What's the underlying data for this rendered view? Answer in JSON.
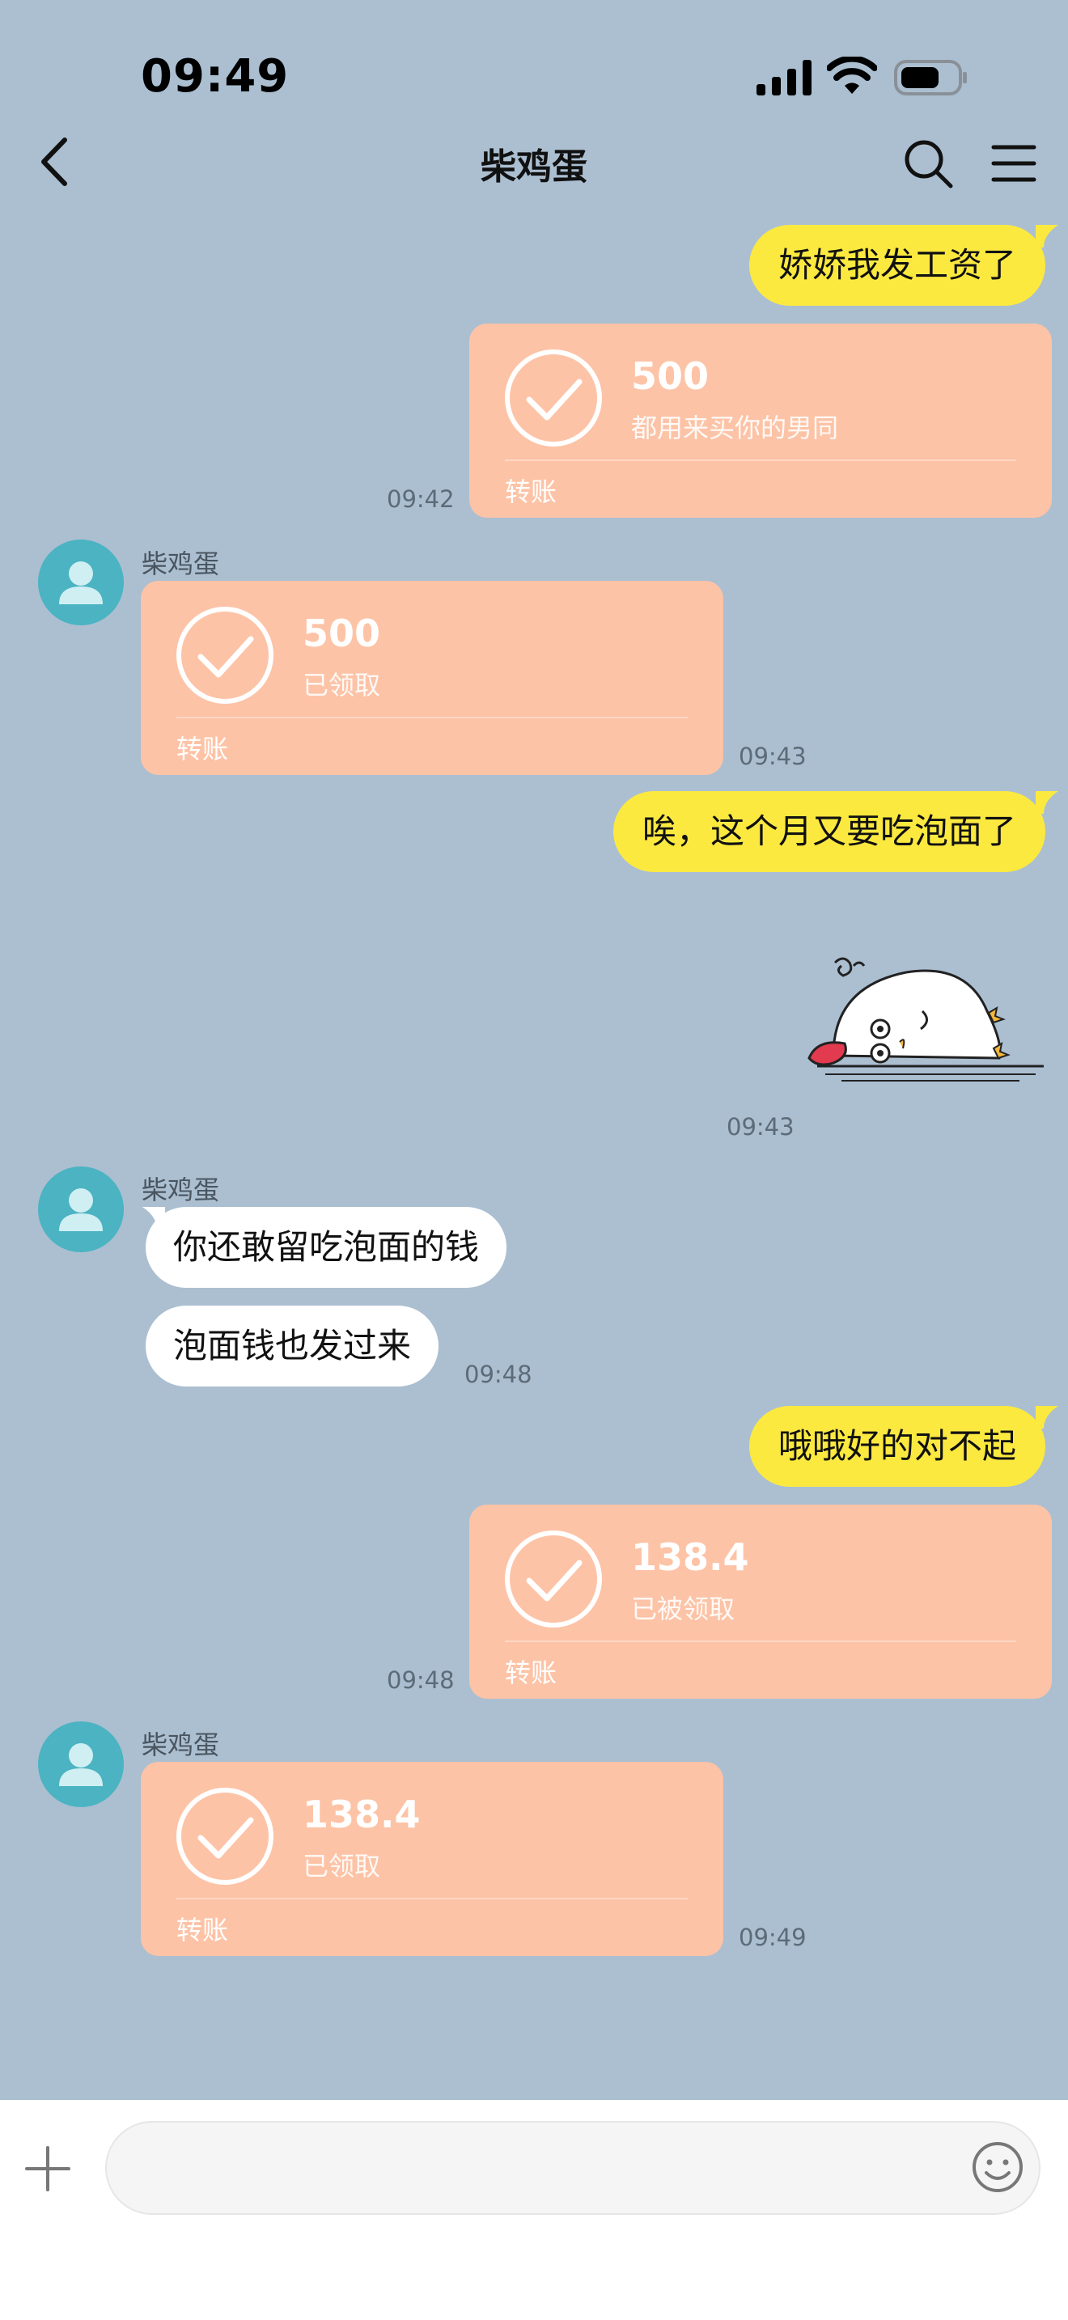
{
  "status_bar": {
    "time": "09:49"
  },
  "header": {
    "title": "柴鸡蛋"
  },
  "messages": {
    "m1_text": "娇娇我发工资了",
    "m2": {
      "amount": "500",
      "note": "都用来买你的男同",
      "label": "转账",
      "time": "09:42"
    },
    "m3": {
      "sender": "柴鸡蛋",
      "amount": "500",
      "note": "已领取",
      "label": "转账",
      "time": "09:43"
    },
    "m4_text": "唉，这个月又要吃泡面了",
    "m5": {
      "time": "09:43"
    },
    "m6": {
      "sender": "柴鸡蛋",
      "text1": "你还敢留吃泡面的钱",
      "text2": "泡面钱也发过来",
      "time": "09:48"
    },
    "m7_text": "哦哦好的对不起",
    "m8": {
      "amount": "138.4",
      "note": "已被领取",
      "label": "转账",
      "time": "09:48"
    },
    "m9": {
      "sender": "柴鸡蛋",
      "amount": "138.4",
      "note": "已领取",
      "label": "转账",
      "time": "09:49"
    }
  },
  "input": {
    "placeholder": ""
  },
  "colors": {
    "background": "#abbfd1",
    "my_bubble": "#fbe940",
    "their_bubble": "#ffffff",
    "transfer_card": "#fdc3a6",
    "avatar": "#4bb3c2"
  },
  "icons": [
    "back-icon",
    "search-icon",
    "menu-icon",
    "signal-icon",
    "wifi-icon",
    "battery-icon",
    "check-circle-icon",
    "person-icon",
    "plus-icon",
    "emoji-icon",
    "sticker-crying-blob"
  ]
}
